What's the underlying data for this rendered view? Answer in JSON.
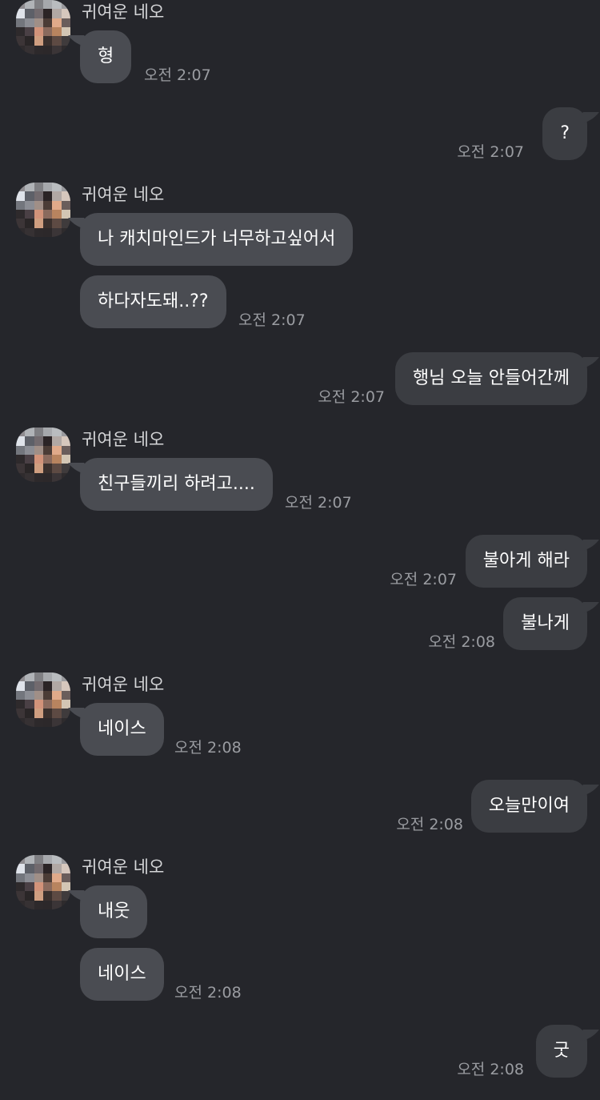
{
  "contact": {
    "name": "귀여운 네오",
    "avatar_colors": [
      "#8f8c90",
      "#b0b3b7",
      "#7f7f83",
      "#a6a8ac",
      "#b9bcbf",
      "#9a9a9e",
      "#dfe3ea",
      "#5d6068",
      "#726a6e",
      "#2b2426",
      "#b1a8a4",
      "#d6c7bd",
      "#73767d",
      "#8b8d94",
      "#a08f87",
      "#4b3c36",
      "#e0aa8a",
      "#6a5d5b",
      "#2e2a2c",
      "#4a4045",
      "#d2937a",
      "#8a6a5d",
      "#b8845f",
      "#d3c6b4",
      "#3c3537",
      "#2a2627",
      "#cf9e80",
      "#3a302d",
      "#5d4a43",
      "#3f3b3c",
      "#2f2b2d",
      "#363133",
      "#2d292b",
      "#2c282a",
      "#3b3537",
      "#2e2b2d"
    ]
  },
  "messages": [
    {
      "side": "in",
      "text": "형",
      "time": "오전 2:07"
    },
    {
      "side": "out",
      "text": "?",
      "time": "오전 2:07"
    },
    {
      "side": "in",
      "text": "나 캐치마인드가 너무하고싶어서",
      "time": ""
    },
    {
      "side": "in",
      "text": "하다자도돼..??",
      "time": "오전 2:07"
    },
    {
      "side": "out",
      "text": "행님 오늘 안들어간께",
      "time": "오전 2:07"
    },
    {
      "side": "in",
      "text": "친구들끼리 하려고....",
      "time": "오전 2:07"
    },
    {
      "side": "out",
      "text": "불아게 해라",
      "time": "오전 2:07"
    },
    {
      "side": "out",
      "text": "불나게",
      "time": "오전 2:08"
    },
    {
      "side": "in",
      "text": "네이스",
      "time": "오전 2:08"
    },
    {
      "side": "out",
      "text": "오늘만이여",
      "time": "오전 2:08"
    },
    {
      "side": "in",
      "text": "내웃",
      "time": ""
    },
    {
      "side": "in",
      "text": "네이스",
      "time": "오전 2:08"
    },
    {
      "side": "out",
      "text": "굿",
      "time": "오전 2:08"
    }
  ]
}
